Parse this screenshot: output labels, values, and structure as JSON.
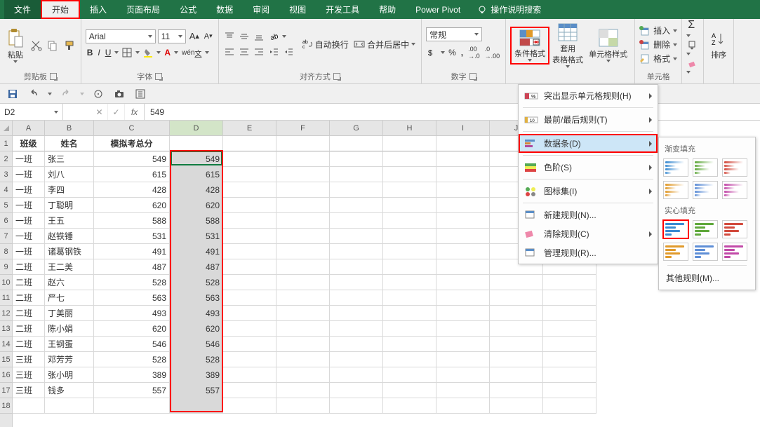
{
  "tabs": {
    "file": "文件",
    "home": "开始",
    "insert": "插入",
    "layout": "页面布局",
    "formulas": "公式",
    "data": "数据",
    "review": "审阅",
    "view": "视图",
    "dev": "开发工具",
    "help": "帮助",
    "powerpivot": "Power Pivot",
    "tellme": "操作说明搜索"
  },
  "ribbon": {
    "clipboard": "剪贴板",
    "paste": "粘贴",
    "font": "字体",
    "font_name": "Arial",
    "font_size": "11",
    "align": "对齐方式",
    "wrap": "自动换行",
    "merge": "合并后居中",
    "number": "数字",
    "number_format": "常规",
    "styles": "",
    "cond_format": "条件格式",
    "format_table": "套用\n表格格式",
    "cell_styles": "单元格样式",
    "cells": "单元格",
    "insert": "插入",
    "delete": "删除",
    "format": "格式",
    "editing": "",
    "sort": "排序"
  },
  "cf_menu": {
    "highlight": "突出显示单元格规则(H)",
    "top": "最前/最后规则(T)",
    "databar": "数据条(D)",
    "colorscale": "色阶(S)",
    "iconset": "图标集(I)",
    "newrule": "新建规则(N)...",
    "clear": "清除规则(C)",
    "manage": "管理规则(R)..."
  },
  "databar_panel": {
    "gradient": "渐变填充",
    "solid": "实心填充",
    "other": "其他规则(M)..."
  },
  "databar_colors": {
    "gradient": [
      "#3b8bd1",
      "#60a83c",
      "#d24a3d",
      "#e09a2b",
      "#5e8ed6",
      "#c24aa8"
    ],
    "solid": [
      "#3b8bd1",
      "#60a83c",
      "#d24a3d",
      "#e09a2b",
      "#5e8ed6",
      "#c24aa8"
    ]
  },
  "formula_bar": {
    "cell_ref": "D2",
    "value": "549"
  },
  "columns": [
    "A",
    "B",
    "C",
    "D",
    "E",
    "F",
    "G",
    "H",
    "I",
    "J",
    "K"
  ],
  "headers": {
    "a": "班级",
    "b": "姓名",
    "c": "模拟考总分"
  },
  "rows": [
    {
      "a": "一班",
      "b": "张三",
      "c": 549,
      "d": 549
    },
    {
      "a": "一班",
      "b": "刘八",
      "c": 615,
      "d": 615
    },
    {
      "a": "一班",
      "b": "李四",
      "c": 428,
      "d": 428
    },
    {
      "a": "一班",
      "b": "丁聪明",
      "c": 620,
      "d": 620
    },
    {
      "a": "一班",
      "b": "王五",
      "c": 588,
      "d": 588
    },
    {
      "a": "一班",
      "b": "赵铁锤",
      "c": 531,
      "d": 531
    },
    {
      "a": "一班",
      "b": "诸葛钢铁",
      "c": 491,
      "d": 491
    },
    {
      "a": "二班",
      "b": "王二美",
      "c": 487,
      "d": 487
    },
    {
      "a": "二班",
      "b": "赵六",
      "c": 528,
      "d": 528
    },
    {
      "a": "二班",
      "b": "严七",
      "c": 563,
      "d": 563
    },
    {
      "a": "二班",
      "b": "丁美丽",
      "c": 493,
      "d": 493
    },
    {
      "a": "二班",
      "b": "陈小娟",
      "c": 620,
      "d": 620
    },
    {
      "a": "二班",
      "b": "王钢蛋",
      "c": 546,
      "d": 546
    },
    {
      "a": "三班",
      "b": "邓芳芳",
      "c": 528,
      "d": 528
    },
    {
      "a": "三班",
      "b": "张小明",
      "c": 389,
      "d": 389
    },
    {
      "a": "三班",
      "b": "钱多",
      "c": 557,
      "d": 557
    }
  ],
  "chart_data": {
    "type": "table",
    "title": "模拟考总分",
    "columns": [
      "班级",
      "姓名",
      "模拟考总分"
    ],
    "rows": [
      [
        "一班",
        "张三",
        549
      ],
      [
        "一班",
        "刘八",
        615
      ],
      [
        "一班",
        "李四",
        428
      ],
      [
        "一班",
        "丁聪明",
        620
      ],
      [
        "一班",
        "王五",
        588
      ],
      [
        "一班",
        "赵铁锤",
        531
      ],
      [
        "一班",
        "诸葛钢铁",
        491
      ],
      [
        "二班",
        "王二美",
        487
      ],
      [
        "二班",
        "赵六",
        528
      ],
      [
        "二班",
        "严七",
        563
      ],
      [
        "二班",
        "丁美丽",
        493
      ],
      [
        "二班",
        "陈小娟",
        620
      ],
      [
        "二班",
        "王钢蛋",
        546
      ],
      [
        "三班",
        "邓芳芳",
        528
      ],
      [
        "三班",
        "张小明",
        389
      ],
      [
        "三班",
        "钱多",
        557
      ]
    ]
  }
}
